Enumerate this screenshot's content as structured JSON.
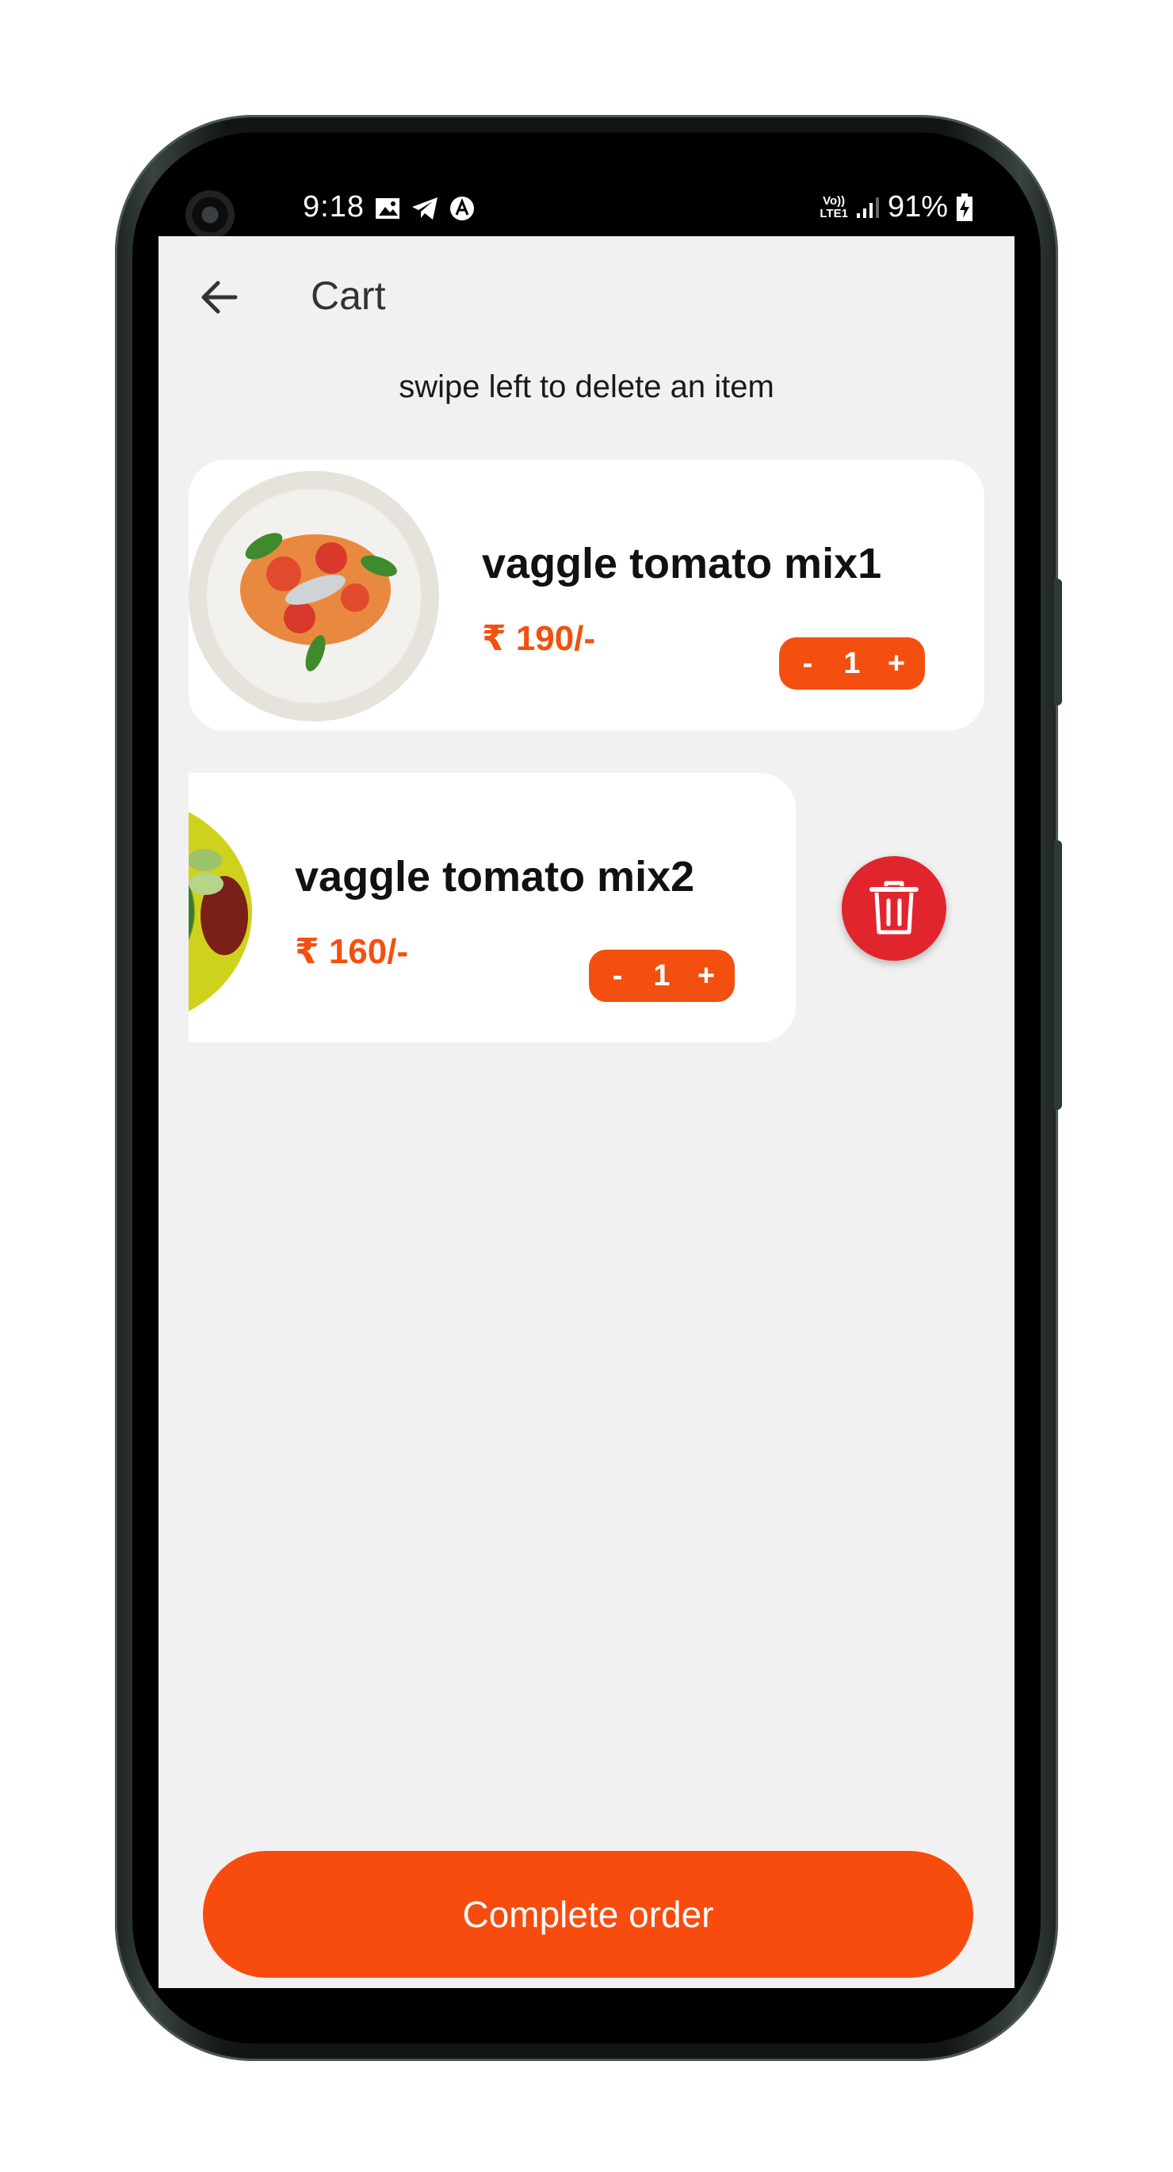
{
  "status_bar": {
    "time": "9:18",
    "network": [
      "Vo))",
      "LTE1"
    ],
    "battery": "91%"
  },
  "header": {
    "title": "Cart",
    "back_icon": "arrow-left-icon"
  },
  "hint": "swipe left to delete an item",
  "cart_items": [
    {
      "name": "vaggle tomato mix1",
      "price": "₹ 190/-",
      "qty_minus": "-",
      "quantity": "1",
      "qty_plus": "+"
    },
    {
      "name": "vaggle tomato mix2",
      "price": "₹ 160/-",
      "qty_minus": "-",
      "quantity": "1",
      "qty_plus": "+"
    }
  ],
  "delete_icon": "trash-icon",
  "complete_order_label": "Complete order",
  "colors": {
    "accent": "#f3500f",
    "delete": "#e1252d",
    "background": "#f1f1f1"
  }
}
